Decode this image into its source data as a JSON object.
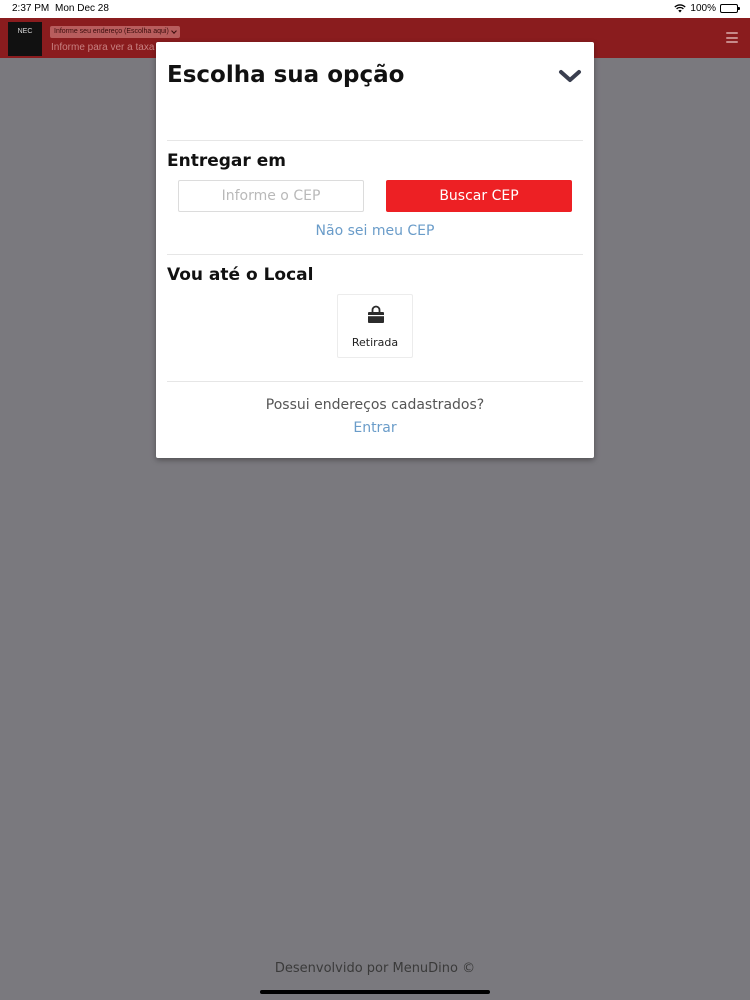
{
  "status_bar": {
    "time": "2:37 PM",
    "date": "Mon Dec 28",
    "battery": "100%",
    "icons": [
      "wifi-icon",
      "battery-icon"
    ]
  },
  "header": {
    "logo_text": "NEC",
    "address_button_label": "Informe seu endereço (Escolha aqui)",
    "tax_info": "Informe para ver a taxa"
  },
  "modal": {
    "title": "Escolha sua opção",
    "deliver_section": {
      "title": "Entregar em",
      "cep_placeholder": "Informe o CEP",
      "cep_value": "",
      "search_button": "Buscar CEP",
      "unknown_cep_link": "Não sei meu CEP"
    },
    "pickup_section": {
      "title": "Vou até o Local",
      "option_label": "Retirada",
      "option_icon": "shopping-bag-icon"
    },
    "registered": {
      "question": "Possui endereços cadastrados?",
      "login_link": "Entrar"
    }
  },
  "footer": {
    "credit": "Desenvolvido por MenuDino ©"
  },
  "colors": {
    "overlay": "#7a797e",
    "header": "#8a1c1e",
    "primary_button": "#ed2024",
    "link": "#6a9cc9"
  }
}
